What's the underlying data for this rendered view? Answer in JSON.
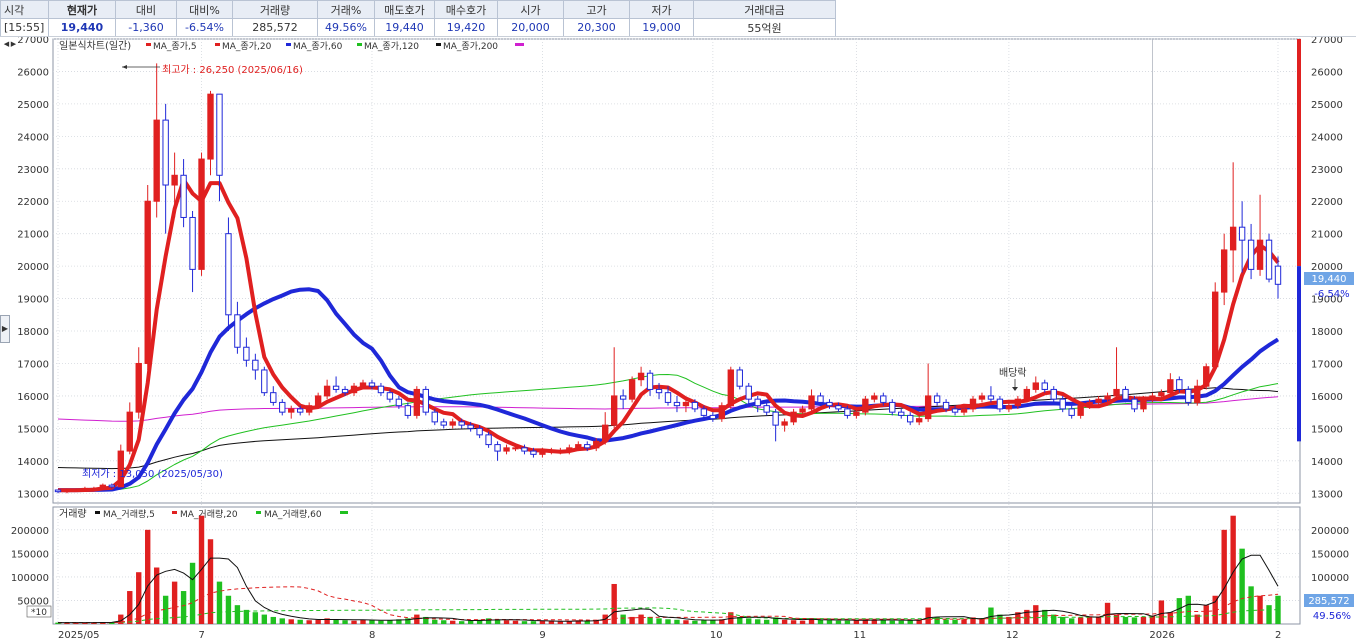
{
  "quote": {
    "headers": [
      "시각",
      "현재가",
      "대비",
      "대비%",
      "거래량",
      "거래%",
      "매도호가",
      "매수호가",
      "시가",
      "고가",
      "저가",
      "거래대금"
    ],
    "values": [
      "[15:55]",
      "19,440",
      "-1,360",
      "-6.54%",
      "285,572",
      "49.56%",
      "19,440",
      "19,420",
      "20,000",
      "20,300",
      "19,000",
      "55억원"
    ]
  },
  "price_panel": {
    "legend": {
      "title": "일본식차트(일간)",
      "items": [
        {
          "label": "MA_종가,5",
          "color": "#e02020"
        },
        {
          "label": "MA_종가,20",
          "color": "#e02020"
        },
        {
          "label": "MA_종가,60",
          "color": "#1f28d8"
        },
        {
          "label": "MA_종가,120",
          "color": "#20c020"
        },
        {
          "label": "MA_종가,200",
          "color": "#111111"
        }
      ],
      "extra_color": "#d020d0"
    },
    "high_annotation": "최고가 : 26,250 (2025/06/16)",
    "low_annotation": "최저가 : 13,050 (2025/05/30)",
    "event_annotation": "배당락",
    "current_price_badge": "19,440",
    "change_pct_label": "-6.54%"
  },
  "volume_panel": {
    "legend": {
      "title": "거래량",
      "items": [
        {
          "label": "MA_거래량,5",
          "color": "#111111"
        },
        {
          "label": "MA_거래량,20",
          "color": "#e02020"
        },
        {
          "label": "MA_거래량,60",
          "color": "#20c020"
        }
      ]
    },
    "multiplier_label": "*10",
    "current_volume_badge": "285,572",
    "volume_pct_label": "49.56%"
  },
  "x_axis_labels": [
    "2025/05",
    "7",
    "8",
    "9",
    "10",
    "11",
    "12",
    "2026",
    "2"
  ],
  "colors": {
    "up": "#e02020",
    "down": "#1f28d8",
    "ma5": "#e02020",
    "ma20": "#1f28d8",
    "ma60": "#20c020",
    "ma120": "#111111",
    "ma200": "#d020d0",
    "badge": "#6fa5e6"
  },
  "chart_data": [
    {
      "type": "candlestick",
      "title": "일본식차트(일간)",
      "ylim": [
        12700,
        27000
      ],
      "y_ticks": [
        13000,
        14000,
        15000,
        16000,
        17000,
        18000,
        19000,
        20000,
        21000,
        22000,
        23000,
        24000,
        25000,
        26000,
        27000
      ],
      "x_period": [
        "2025/05",
        "2026/02"
      ],
      "highlights": {
        "high": 26250,
        "high_date": "2025/06/16",
        "low": 13050,
        "low_date": "2025/05/30",
        "last_close": 19440
      },
      "candles": [
        [
          13100,
          13100,
          13000,
          13050
        ],
        [
          13050,
          13150,
          13000,
          13100
        ],
        [
          13100,
          13150,
          13050,
          13100
        ],
        [
          13100,
          13200,
          13050,
          13150
        ],
        [
          13150,
          13200,
          13100,
          13150
        ],
        [
          13150,
          13300,
          13100,
          13250
        ],
        [
          13250,
          13300,
          13150,
          13200
        ],
        [
          13200,
          14500,
          13200,
          14300
        ],
        [
          14300,
          15800,
          14200,
          15500
        ],
        [
          15500,
          17500,
          15300,
          17000
        ],
        [
          17000,
          22500,
          16800,
          22000
        ],
        [
          22000,
          26250,
          21500,
          24500
        ],
        [
          24500,
          25000,
          21000,
          22500
        ],
        [
          22500,
          23500,
          21500,
          22800
        ],
        [
          22800,
          23300,
          21200,
          21500
        ],
        [
          21500,
          21700,
          19200,
          19900
        ],
        [
          19900,
          23500,
          19700,
          23300
        ],
        [
          23300,
          25400,
          22800,
          25300
        ],
        [
          25300,
          24500,
          22000,
          22800
        ],
        [
          21000,
          21500,
          18000,
          18500
        ],
        [
          18500,
          18900,
          17300,
          17500
        ],
        [
          17500,
          17800,
          16900,
          17100
        ],
        [
          17100,
          17300,
          16500,
          16800
        ],
        [
          16800,
          16900,
          16000,
          16100
        ],
        [
          16100,
          16300,
          15700,
          15800
        ],
        [
          15800,
          15900,
          15400,
          15500
        ],
        [
          15500,
          15700,
          15300,
          15600
        ],
        [
          15600,
          15700,
          15400,
          15500
        ],
        [
          15500,
          15800,
          15400,
          15700
        ],
        [
          15700,
          16100,
          15600,
          16000
        ],
        [
          16000,
          16500,
          15900,
          16300
        ],
        [
          16300,
          16600,
          16100,
          16200
        ],
        [
          16200,
          16300,
          16000,
          16100
        ],
        [
          16100,
          16400,
          16000,
          16300
        ],
        [
          16300,
          16500,
          16200,
          16400
        ],
        [
          16400,
          16500,
          16200,
          16300
        ],
        [
          16300,
          16400,
          16000,
          16100
        ],
        [
          16100,
          16200,
          15800,
          15900
        ],
        [
          15900,
          16000,
          15600,
          15700
        ],
        [
          15700,
          15800,
          15300,
          15400
        ],
        [
          15400,
          16300,
          15300,
          16200
        ],
        [
          16200,
          16300,
          15400,
          15500
        ],
        [
          15500,
          15600,
          15100,
          15200
        ],
        [
          15200,
          15300,
          15000,
          15100
        ],
        [
          15100,
          15300,
          15000,
          15200
        ],
        [
          15200,
          15300,
          15000,
          15100
        ],
        [
          15100,
          15200,
          14900,
          15000
        ],
        [
          15000,
          15100,
          14700,
          14800
        ],
        [
          14800,
          14900,
          14400,
          14500
        ],
        [
          14500,
          14600,
          14000,
          14300
        ],
        [
          14300,
          14500,
          14200,
          14400
        ],
        [
          14400,
          14500,
          14300,
          14400
        ],
        [
          14400,
          14500,
          14200,
          14300
        ],
        [
          14300,
          14400,
          14100,
          14200
        ],
        [
          14200,
          14400,
          14100,
          14300
        ],
        [
          14300,
          14400,
          14200,
          14300
        ],
        [
          14300,
          14400,
          14200,
          14300
        ],
        [
          14300,
          14500,
          14200,
          14400
        ],
        [
          14400,
          14600,
          14300,
          14500
        ],
        [
          14500,
          14600,
          14300,
          14400
        ],
        [
          14400,
          14700,
          14300,
          14600
        ],
        [
          14600,
          15500,
          14500,
          15100
        ],
        [
          15100,
          17500,
          15000,
          16000
        ],
        [
          16000,
          16200,
          15600,
          15900
        ],
        [
          15900,
          16600,
          15800,
          16500
        ],
        [
          16500,
          16900,
          16300,
          16700
        ],
        [
          16700,
          16800,
          16000,
          16200
        ],
        [
          16200,
          16400,
          15900,
          16100
        ],
        [
          16100,
          16300,
          15700,
          15800
        ],
        [
          15800,
          16000,
          15500,
          15700
        ],
        [
          15700,
          15900,
          15500,
          15800
        ],
        [
          15800,
          15900,
          15500,
          15600
        ],
        [
          15600,
          15700,
          15300,
          15400
        ],
        [
          15400,
          15500,
          15200,
          15300
        ],
        [
          15300,
          15800,
          15200,
          15700
        ],
        [
          15700,
          16900,
          15600,
          16800
        ],
        [
          16800,
          16900,
          16200,
          16300
        ],
        [
          16300,
          16400,
          15700,
          15900
        ],
        [
          15900,
          16000,
          15500,
          15700
        ],
        [
          15700,
          15800,
          15400,
          15500
        ],
        [
          15500,
          15600,
          14600,
          15100
        ],
        [
          15100,
          15300,
          14900,
          15200
        ],
        [
          15200,
          15600,
          15100,
          15500
        ],
        [
          15500,
          15700,
          15400,
          15600
        ],
        [
          15600,
          16200,
          15500,
          16000
        ],
        [
          16000,
          16100,
          15700,
          15800
        ],
        [
          15800,
          15900,
          15600,
          15700
        ],
        [
          15700,
          15800,
          15500,
          15600
        ],
        [
          15600,
          15700,
          15300,
          15400
        ],
        [
          15400,
          15600,
          15300,
          15500
        ],
        [
          15500,
          16000,
          15400,
          15900
        ],
        [
          15900,
          16100,
          15800,
          16000
        ],
        [
          16000,
          16100,
          15700,
          15800
        ],
        [
          15800,
          15900,
          15400,
          15500
        ],
        [
          15500,
          15600,
          15300,
          15400
        ],
        [
          15400,
          15500,
          15100,
          15200
        ],
        [
          15200,
          15400,
          15100,
          15300
        ],
        [
          15300,
          17000,
          15200,
          16000
        ],
        [
          16000,
          16100,
          15700,
          15800
        ],
        [
          15800,
          15900,
          15500,
          15600
        ],
        [
          15600,
          15700,
          15400,
          15500
        ],
        [
          15500,
          15700,
          15400,
          15600
        ],
        [
          15600,
          16000,
          15500,
          15900
        ],
        [
          15900,
          16100,
          15800,
          16000
        ],
        [
          16000,
          16300,
          15800,
          15900
        ],
        [
          15900,
          16000,
          15500,
          15600
        ],
        [
          15600,
          15800,
          15500,
          15700
        ],
        [
          15700,
          16000,
          15600,
          15900
        ],
        [
          15900,
          16300,
          15800,
          16200
        ],
        [
          16200,
          16600,
          16100,
          16400
        ],
        [
          16400,
          16500,
          16100,
          16200
        ],
        [
          16200,
          16300,
          15800,
          15900
        ],
        [
          15900,
          16000,
          15500,
          15600
        ],
        [
          15600,
          15700,
          15300,
          15400
        ],
        [
          15400,
          15800,
          15300,
          15700
        ],
        [
          15700,
          15900,
          15600,
          15800
        ],
        [
          15800,
          16000,
          15700,
          15900
        ],
        [
          15900,
          16100,
          15800,
          16000
        ],
        [
          16000,
          17500,
          15900,
          16200
        ],
        [
          16200,
          16300,
          15800,
          15900
        ],
        [
          15900,
          16000,
          15500,
          15600
        ],
        [
          15600,
          16000,
          15500,
          15900
        ],
        [
          15900,
          16100,
          15800,
          16000
        ],
        [
          16000,
          16200,
          15900,
          16100
        ],
        [
          16100,
          16700,
          16000,
          16500
        ],
        [
          16500,
          16600,
          16100,
          16200
        ],
        [
          16200,
          16300,
          15700,
          15800
        ],
        [
          15800,
          16500,
          15700,
          16300
        ],
        [
          16300,
          17000,
          16200,
          16900
        ],
        [
          16900,
          19500,
          16800,
          19200
        ],
        [
          19200,
          21000,
          18800,
          20500
        ],
        [
          20500,
          23200,
          19500,
          21200
        ],
        [
          21200,
          22000,
          19800,
          20800
        ],
        [
          20800,
          21300,
          19600,
          19900
        ],
        [
          19900,
          22200,
          19700,
          20800
        ],
        [
          20800,
          21000,
          19500,
          19600
        ],
        [
          20000,
          20300,
          19000,
          19440
        ]
      ],
      "volume": [
        3000,
        2500,
        3500,
        3000,
        2800,
        4000,
        3500,
        20000,
        70000,
        110000,
        200000,
        120000,
        60000,
        90000,
        70000,
        130000,
        230000,
        180000,
        90000,
        60000,
        40000,
        30000,
        25000,
        20000,
        15000,
        12000,
        10000,
        9000,
        8000,
        9000,
        12000,
        10000,
        8000,
        7000,
        9000,
        8000,
        7000,
        8000,
        10000,
        12000,
        20000,
        15000,
        9000,
        8000,
        7000,
        6000,
        7000,
        9000,
        12000,
        10000,
        8000,
        7000,
        6000,
        6000,
        7000,
        6000,
        5000,
        6000,
        8000,
        7000,
        9000,
        20000,
        85000,
        20000,
        15000,
        20000,
        15000,
        12000,
        10000,
        9000,
        8000,
        7000,
        8000,
        9000,
        10000,
        25000,
        15000,
        12000,
        10000,
        9000,
        14000,
        9000,
        8000,
        7000,
        12000,
        9000,
        8000,
        7000,
        7000,
        8000,
        10000,
        9000,
        8000,
        7000,
        7000,
        8000,
        9000,
        35000,
        15000,
        10000,
        9000,
        10000,
        14000,
        12000,
        35000,
        20000,
        15000,
        25000,
        30000,
        40000,
        30000,
        20000,
        15000,
        12000,
        14000,
        15000,
        16000,
        45000,
        20000,
        15000,
        14000,
        15000,
        18000,
        50000,
        25000,
        55000,
        60000,
        20000,
        40000,
        60000,
        200000,
        230000,
        160000,
        80000,
        60000,
        40000,
        60000
      ]
    }
  ]
}
